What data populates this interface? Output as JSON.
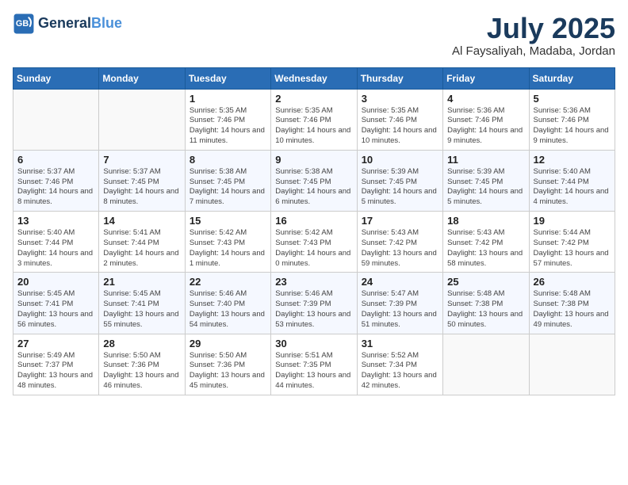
{
  "header": {
    "logo_line1": "General",
    "logo_line2": "Blue",
    "month": "July 2025",
    "location": "Al Faysaliyah, Madaba, Jordan"
  },
  "weekdays": [
    "Sunday",
    "Monday",
    "Tuesday",
    "Wednesday",
    "Thursday",
    "Friday",
    "Saturday"
  ],
  "weeks": [
    [
      {
        "day": "",
        "detail": ""
      },
      {
        "day": "",
        "detail": ""
      },
      {
        "day": "1",
        "detail": "Sunrise: 5:35 AM\nSunset: 7:46 PM\nDaylight: 14 hours and 11 minutes."
      },
      {
        "day": "2",
        "detail": "Sunrise: 5:35 AM\nSunset: 7:46 PM\nDaylight: 14 hours and 10 minutes."
      },
      {
        "day": "3",
        "detail": "Sunrise: 5:35 AM\nSunset: 7:46 PM\nDaylight: 14 hours and 10 minutes."
      },
      {
        "day": "4",
        "detail": "Sunrise: 5:36 AM\nSunset: 7:46 PM\nDaylight: 14 hours and 9 minutes."
      },
      {
        "day": "5",
        "detail": "Sunrise: 5:36 AM\nSunset: 7:46 PM\nDaylight: 14 hours and 9 minutes."
      }
    ],
    [
      {
        "day": "6",
        "detail": "Sunrise: 5:37 AM\nSunset: 7:46 PM\nDaylight: 14 hours and 8 minutes."
      },
      {
        "day": "7",
        "detail": "Sunrise: 5:37 AM\nSunset: 7:45 PM\nDaylight: 14 hours and 8 minutes."
      },
      {
        "day": "8",
        "detail": "Sunrise: 5:38 AM\nSunset: 7:45 PM\nDaylight: 14 hours and 7 minutes."
      },
      {
        "day": "9",
        "detail": "Sunrise: 5:38 AM\nSunset: 7:45 PM\nDaylight: 14 hours and 6 minutes."
      },
      {
        "day": "10",
        "detail": "Sunrise: 5:39 AM\nSunset: 7:45 PM\nDaylight: 14 hours and 5 minutes."
      },
      {
        "day": "11",
        "detail": "Sunrise: 5:39 AM\nSunset: 7:45 PM\nDaylight: 14 hours and 5 minutes."
      },
      {
        "day": "12",
        "detail": "Sunrise: 5:40 AM\nSunset: 7:44 PM\nDaylight: 14 hours and 4 minutes."
      }
    ],
    [
      {
        "day": "13",
        "detail": "Sunrise: 5:40 AM\nSunset: 7:44 PM\nDaylight: 14 hours and 3 minutes."
      },
      {
        "day": "14",
        "detail": "Sunrise: 5:41 AM\nSunset: 7:44 PM\nDaylight: 14 hours and 2 minutes."
      },
      {
        "day": "15",
        "detail": "Sunrise: 5:42 AM\nSunset: 7:43 PM\nDaylight: 14 hours and 1 minute."
      },
      {
        "day": "16",
        "detail": "Sunrise: 5:42 AM\nSunset: 7:43 PM\nDaylight: 14 hours and 0 minutes."
      },
      {
        "day": "17",
        "detail": "Sunrise: 5:43 AM\nSunset: 7:42 PM\nDaylight: 13 hours and 59 minutes."
      },
      {
        "day": "18",
        "detail": "Sunrise: 5:43 AM\nSunset: 7:42 PM\nDaylight: 13 hours and 58 minutes."
      },
      {
        "day": "19",
        "detail": "Sunrise: 5:44 AM\nSunset: 7:42 PM\nDaylight: 13 hours and 57 minutes."
      }
    ],
    [
      {
        "day": "20",
        "detail": "Sunrise: 5:45 AM\nSunset: 7:41 PM\nDaylight: 13 hours and 56 minutes."
      },
      {
        "day": "21",
        "detail": "Sunrise: 5:45 AM\nSunset: 7:41 PM\nDaylight: 13 hours and 55 minutes."
      },
      {
        "day": "22",
        "detail": "Sunrise: 5:46 AM\nSunset: 7:40 PM\nDaylight: 13 hours and 54 minutes."
      },
      {
        "day": "23",
        "detail": "Sunrise: 5:46 AM\nSunset: 7:39 PM\nDaylight: 13 hours and 53 minutes."
      },
      {
        "day": "24",
        "detail": "Sunrise: 5:47 AM\nSunset: 7:39 PM\nDaylight: 13 hours and 51 minutes."
      },
      {
        "day": "25",
        "detail": "Sunrise: 5:48 AM\nSunset: 7:38 PM\nDaylight: 13 hours and 50 minutes."
      },
      {
        "day": "26",
        "detail": "Sunrise: 5:48 AM\nSunset: 7:38 PM\nDaylight: 13 hours and 49 minutes."
      }
    ],
    [
      {
        "day": "27",
        "detail": "Sunrise: 5:49 AM\nSunset: 7:37 PM\nDaylight: 13 hours and 48 minutes."
      },
      {
        "day": "28",
        "detail": "Sunrise: 5:50 AM\nSunset: 7:36 PM\nDaylight: 13 hours and 46 minutes."
      },
      {
        "day": "29",
        "detail": "Sunrise: 5:50 AM\nSunset: 7:36 PM\nDaylight: 13 hours and 45 minutes."
      },
      {
        "day": "30",
        "detail": "Sunrise: 5:51 AM\nSunset: 7:35 PM\nDaylight: 13 hours and 44 minutes."
      },
      {
        "day": "31",
        "detail": "Sunrise: 5:52 AM\nSunset: 7:34 PM\nDaylight: 13 hours and 42 minutes."
      },
      {
        "day": "",
        "detail": ""
      },
      {
        "day": "",
        "detail": ""
      }
    ]
  ]
}
